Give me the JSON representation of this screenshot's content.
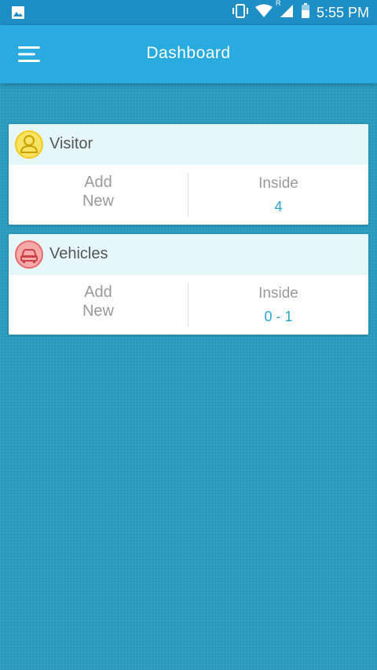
{
  "status_bar": {
    "time": "5:55 PM",
    "icons": [
      "image-icon",
      "vibrate-icon",
      "wifi-icon",
      "roaming-indicator",
      "signal-icon",
      "battery-icon"
    ],
    "roaming_label": "R"
  },
  "app_bar": {
    "title": "Dashboard",
    "menu_icon": "hamburger-menu-icon",
    "color": "#29abe0"
  },
  "cards": [
    {
      "title": "Visitor",
      "icon": "person-icon",
      "icon_color": "#f4d31f",
      "add_new_line1": "Add",
      "add_new_line2": "New",
      "inside_label": "Inside",
      "inside_count": "4"
    },
    {
      "title": "Vehicles",
      "icon": "car-icon",
      "icon_color": "#e86a6a",
      "add_new_line1": "Add",
      "add_new_line2": "New",
      "inside_label": "Inside",
      "inside_count": "0 - 1"
    }
  ],
  "colors": {
    "background": "#2a9dc0",
    "accent_text": "#2aa5cf",
    "card_header": "#e6f7fc"
  }
}
